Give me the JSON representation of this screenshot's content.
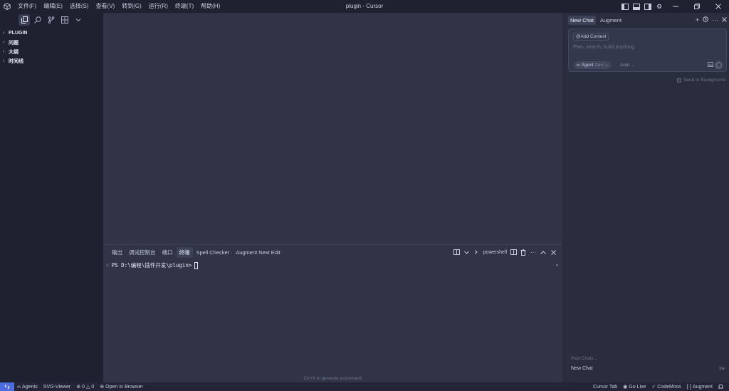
{
  "window": {
    "title": "plugin - Cursor"
  },
  "menu": {
    "items": [
      "文件(F)",
      "编辑(E)",
      "选择(S)",
      "查看(V)",
      "转到(G)",
      "运行(R)",
      "终端(T)",
      "帮助(H)"
    ]
  },
  "sidebar": {
    "tree": [
      {
        "label": "PLUGIN"
      },
      {
        "label": "问题"
      },
      {
        "label": "大纲"
      },
      {
        "label": "时间线"
      }
    ]
  },
  "panel": {
    "tabs": [
      {
        "label": "输出",
        "active": false
      },
      {
        "label": "调试控制台",
        "active": false
      },
      {
        "label": "端口",
        "active": false
      },
      {
        "label": "终端",
        "active": true
      },
      {
        "label": "Spell Checker",
        "active": false
      },
      {
        "label": "Augment Next Edit",
        "active": false
      }
    ],
    "shell_label": "powershell",
    "terminal_prompt": "PS D:\\编程\\插件开发\\plugin>",
    "hint": "Ctrl+K to generate a command"
  },
  "chat": {
    "tabs": [
      "New Chat",
      "Augment"
    ],
    "add_context": "Add Context",
    "placeholder": "Plan, search, build anything",
    "agent_label": "Agent",
    "agent_shortcut": "Ctrl+I",
    "model_label": "Auto",
    "send_to_background": "Send to Background",
    "past_chats_label": "Past Chats",
    "past_chat_item": "New Chat",
    "past_chat_time": "1w"
  },
  "statusbar": {
    "agents": "Agents",
    "svg_viewer": "SVG-Viewer",
    "errors": "0",
    "warnings": "0",
    "open_in_browser": "Open In Browser",
    "cursor_tab": "Cursor Tab",
    "go_live": "Go Live",
    "codemoss": "CodeMoss",
    "augment": "Augment"
  },
  "colors": {
    "accent": "#4c6ce0",
    "background": "#292c3c",
    "sidebar": "#1f2130",
    "editor": "#303446"
  }
}
